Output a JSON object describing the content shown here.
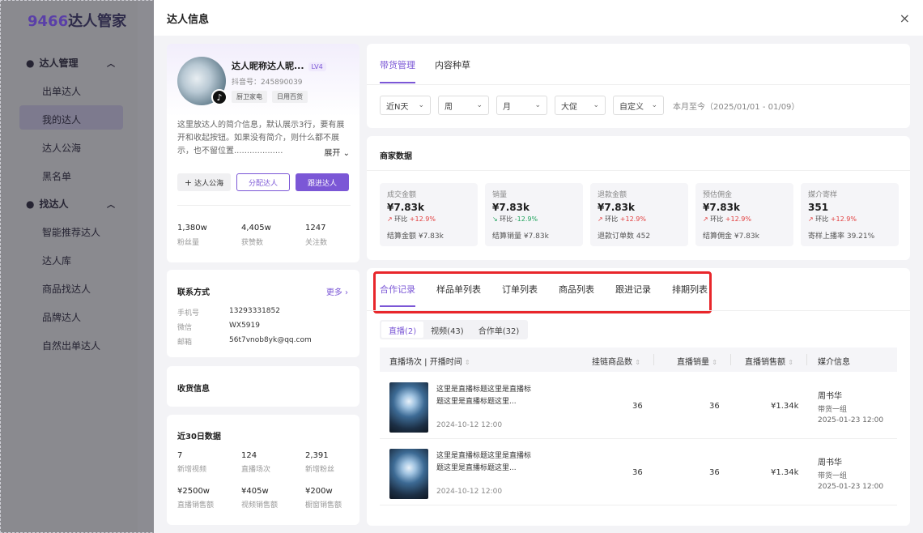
{
  "app": {
    "logo_num": "9466",
    "logo_text": "达人管家"
  },
  "sidebar": {
    "groups": [
      {
        "label": "达人管理",
        "items": [
          "出单达人",
          "我的达人",
          "达人公海",
          "黑名单"
        ]
      },
      {
        "label": "找达人",
        "items": [
          "智能推荐达人",
          "达人库",
          "商品找达人",
          "品牌达人",
          "自然出单达人"
        ]
      }
    ],
    "active_item": "我的达人"
  },
  "modal": {
    "title": "达人信息",
    "close": "×"
  },
  "profile": {
    "name": "达人昵称达人昵...",
    "level": "LV4",
    "douyin_id": "抖音号：245890039",
    "tags": [
      "厨卫家电",
      "日用百货"
    ],
    "description": "这里放达人的简介信息，默认展示3行，要有展开和收起按钮。如果没有简介，则什么都不展示，也不留位置...................",
    "expand_label": "展开",
    "buttons": {
      "public": "达人公海",
      "assign": "分配达人",
      "follow": "跟进达人"
    },
    "stats": [
      {
        "value": "1,380w",
        "label": "粉丝量"
      },
      {
        "value": "4,405w",
        "label": "获赞数"
      },
      {
        "value": "1247",
        "label": "关注数"
      }
    ]
  },
  "contact": {
    "title": "联系方式",
    "more": "更多",
    "rows": [
      {
        "label": "手机号",
        "value": "13293331852"
      },
      {
        "label": "微信",
        "value": "WX5919"
      },
      {
        "label": "邮箱",
        "value": "56t7vnob8yk@qq.com"
      }
    ]
  },
  "shipping": {
    "title": "收货信息"
  },
  "thirty_days": {
    "title": "近30日数据",
    "stats": [
      {
        "value": "7",
        "label": "新增视频"
      },
      {
        "value": "124",
        "label": "直播场次"
      },
      {
        "value": "2,391",
        "label": "新增粉丝"
      },
      {
        "value": "¥2500w",
        "label": "直播销售额"
      },
      {
        "value": "¥405w",
        "label": "视频销售额"
      },
      {
        "value": "¥200w",
        "label": "橱窗销售额"
      }
    ]
  },
  "top_tabs": [
    "带货管理",
    "内容种草"
  ],
  "filters": {
    "selects": [
      "近N天",
      "周",
      "月",
      "大促",
      "自定义"
    ],
    "date_range": "本月至今（2025/01/01 - 01/09）"
  },
  "merchant": {
    "title": "商家数据",
    "metrics": [
      {
        "label": "成交金额",
        "value": "¥7.83k",
        "change_label": "环比",
        "change": "+12.9%",
        "dir": "up",
        "foot": "结算金额 ¥7.83k"
      },
      {
        "label": "销量",
        "value": "¥7.83k",
        "change_label": "环比",
        "change": "-12.9%",
        "dir": "down",
        "foot": "结算销量 ¥7.83k"
      },
      {
        "label": "退款金额",
        "value": "¥7.83k",
        "change_label": "环比",
        "change": "+12.9%",
        "dir": "up",
        "foot": "退款订单数 452"
      },
      {
        "label": "预估佣金",
        "value": "¥7.83k",
        "change_label": "环比",
        "change": "+12.9%",
        "dir": "up",
        "foot": "结算佣金 ¥7.83k"
      },
      {
        "label": "媒介寄样",
        "value": "351",
        "change_label": "环比",
        "change": "+12.9%",
        "dir": "up",
        "foot": "寄样上播率 39.21%"
      }
    ]
  },
  "record_tabs": [
    "合作记录",
    "样品单列表",
    "订单列表",
    "商品列表",
    "跟进记录",
    "排期列表"
  ],
  "sub_tabs": [
    "直播(2)",
    "视频(43)",
    "合作单(32)"
  ],
  "table": {
    "headers": [
      "直播场次 | 开播时间",
      "挂链商品数",
      "直播销量",
      "直播销售额",
      "媒介信息"
    ],
    "rows": [
      {
        "title": "这里是直播标题这里是直播标题这里是直播标题这里...",
        "time": "2024-10-12 12:00",
        "items": "36",
        "sales": "36",
        "revenue": "¥1.34k",
        "media_name": "周书华",
        "media_group": "带货一组",
        "media_date": "2025-01-23 12:00"
      },
      {
        "title": "这里是直播标题这里是直播标题这里是直播标题这里...",
        "time": "2024-10-12 12:00",
        "items": "36",
        "sales": "36",
        "revenue": "¥1.34k",
        "media_name": "周书华",
        "media_group": "带货一组",
        "media_date": "2025-01-23 12:00"
      }
    ]
  },
  "colors": {
    "accent": "#7b57d6",
    "highlight": "#e8262b",
    "up": "#e23c3c",
    "down": "#1ea35b"
  }
}
